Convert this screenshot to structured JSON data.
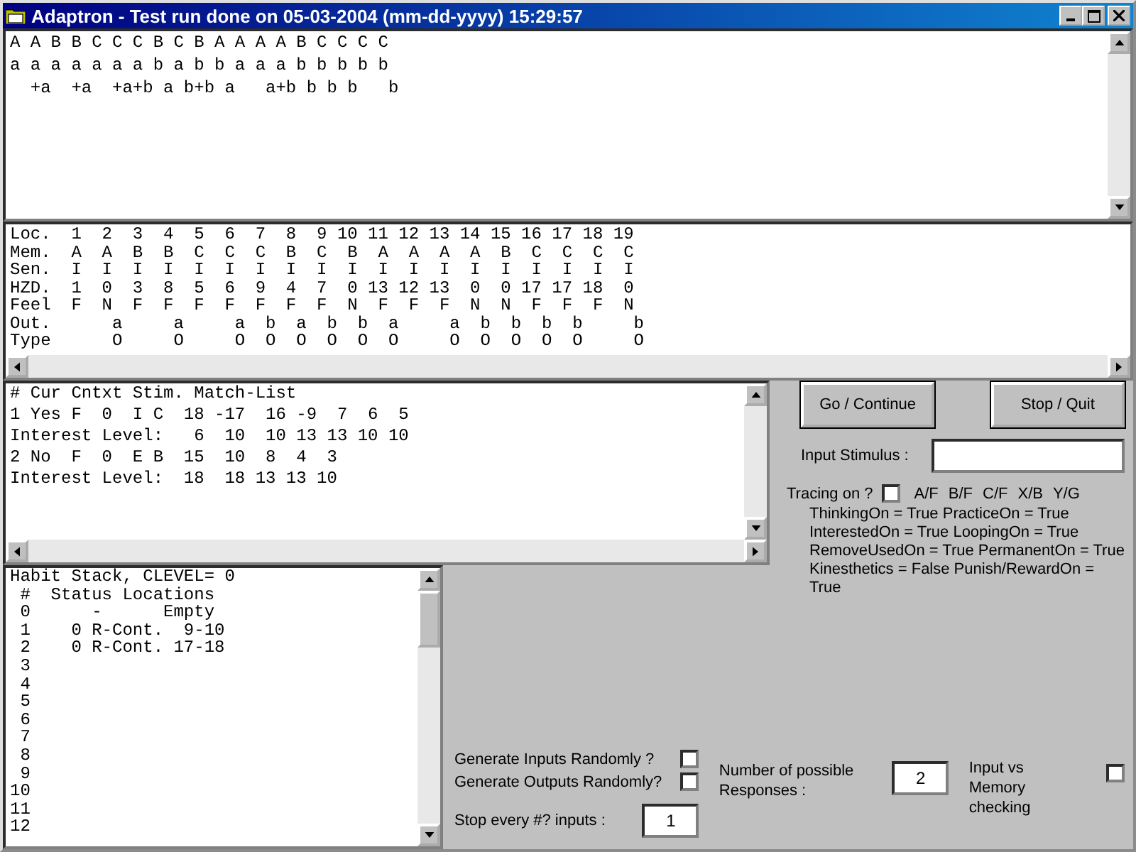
{
  "window": {
    "title": "Adaptron - Test run done on 05-03-2004 (mm-dd-yyyy) 15:29:57"
  },
  "sequence_panel": {
    "lines": [
      "A A B B C C C B C B A A A A B C C C C",
      "a a a a a a a b a b b a a a b b b b b",
      "  +a  +a  +a+b a b+b a   a+b b b b   b"
    ]
  },
  "memory_panel": {
    "lines": [
      "Loc.  1  2  3  4  5  6  7  8  9 10 11 12 13 14 15 16 17 18 19",
      "Mem.  A  A  B  B  C  C  C  B  C  B  A  A  A  A  B  C  C  C  C",
      "Sen.  I  I  I  I  I  I  I  I  I  I  I  I  I  I  I  I  I  I  I",
      "HZD.  1  0  3  8  5  6  9  4  7  0 13 12 13  0  0 17 17 18  0",
      "Feel  F  N  F  F  F  F  F  F  F  N  F  F  F  N  N  F  F  F  N",
      "Out.      a     a     a  b  a  b  b  a     a  b  b  b  b     b",
      "Type      O     O     O  O  O  O  O  O     O  O  O  O  O     O"
    ]
  },
  "match_panel": {
    "lines": [
      "# Cur Cntxt Stim. Match-List",
      "1 Yes F  0  I C  18 -17  16 -9  7  6  5",
      "Interest Level:   6  10  10 13 13 10 10",
      "2 No  F  0  E B  15  10  8  4  3",
      "Interest Level:  18  18 13 13 10"
    ]
  },
  "buttons": [
    {
      "label": "Go / Continue"
    },
    {
      "label": "Stop / Quit"
    }
  ],
  "input_stimulus": {
    "label": "Input Stimulus :"
  },
  "tracing": {
    "label": "Tracing on ?",
    "checked": false,
    "options": [
      "A/F",
      "B/F",
      "C/F",
      "X/B",
      "Y/G"
    ]
  },
  "settings_lines": [
    "ThinkingOn = True PracticeOn = True",
    "InterestedOn = True LoopingOn = True",
    "RemoveUsedOn = True PermanentOn = True",
    "Kinesthetics = False Punish/RewardOn =",
    "True"
  ],
  "habit_stack": {
    "lines": [
      "Habit Stack, CLEVEL= 0",
      " #  Status Locations",
      " 0      -      Empty",
      " 1    0 R-Cont.  9-10",
      " 2    0 R-Cont. 17-18",
      " 3",
      " 4",
      " 5",
      " 6",
      " 7",
      " 8",
      " 9",
      "10",
      "11",
      "12"
    ]
  },
  "random_inputs": {
    "label": "Generate Inputs Randomly ?",
    "checked": false
  },
  "random_outputs": {
    "label": "Generate Outputs Randomly?",
    "checked": false
  },
  "responses": {
    "label": "Number of possible Responses :",
    "value": "2"
  },
  "memory_check": {
    "label": "Input vs Memory checking",
    "checked": false
  },
  "stop_every": {
    "label": "Stop every #? inputs :",
    "value": "1"
  }
}
